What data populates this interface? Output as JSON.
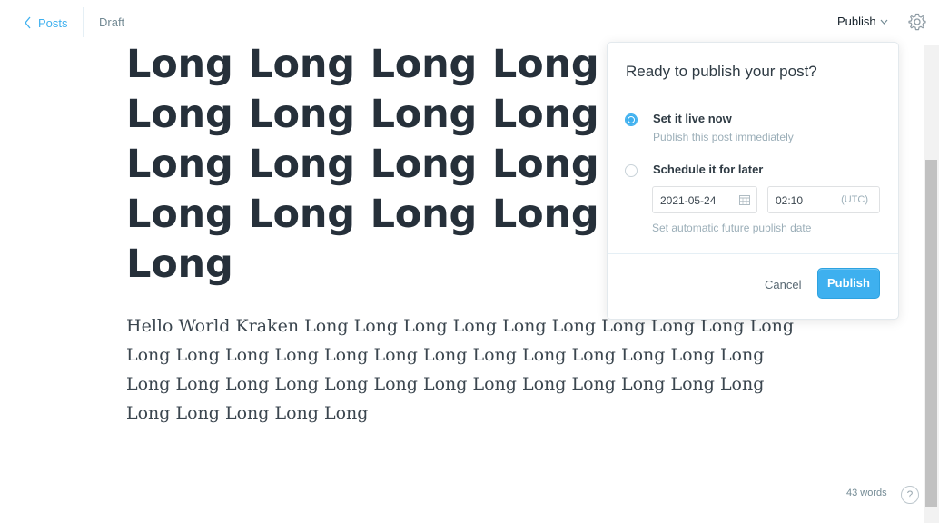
{
  "header": {
    "back_label": "Posts",
    "status": "Draft",
    "publish_label": "Publish"
  },
  "post": {
    "title": "Long Long Long Long Long Long Long Long Long Long Long Long Long Long Long Long Long Long Long Long Long",
    "body": "Hello World Kraken Long Long Long Long Long Long Long Long Long Long Long Long Long Long Long Long Long Long Long Long Long Long Long Long Long Long Long Long Long Long Long Long Long Long Long Long Long Long Long Long Long"
  },
  "footer": {
    "word_count": "43 words",
    "help": "?"
  },
  "publish_menu": {
    "title": "Ready to publish your post?",
    "options": [
      {
        "label": "Set it live now",
        "description": "Publish this post immediately",
        "selected": true
      },
      {
        "label": "Schedule it for later",
        "description": "",
        "selected": false
      }
    ],
    "date_value": "2021-05-24",
    "time_value": "02:10",
    "timezone": "(UTC)",
    "schedule_hint": "Set automatic future publish date",
    "cancel_label": "Cancel",
    "publish_label": "Publish"
  },
  "colors": {
    "accent": "#3eb0ef",
    "text": "#15212a",
    "muted": "#738a94"
  }
}
